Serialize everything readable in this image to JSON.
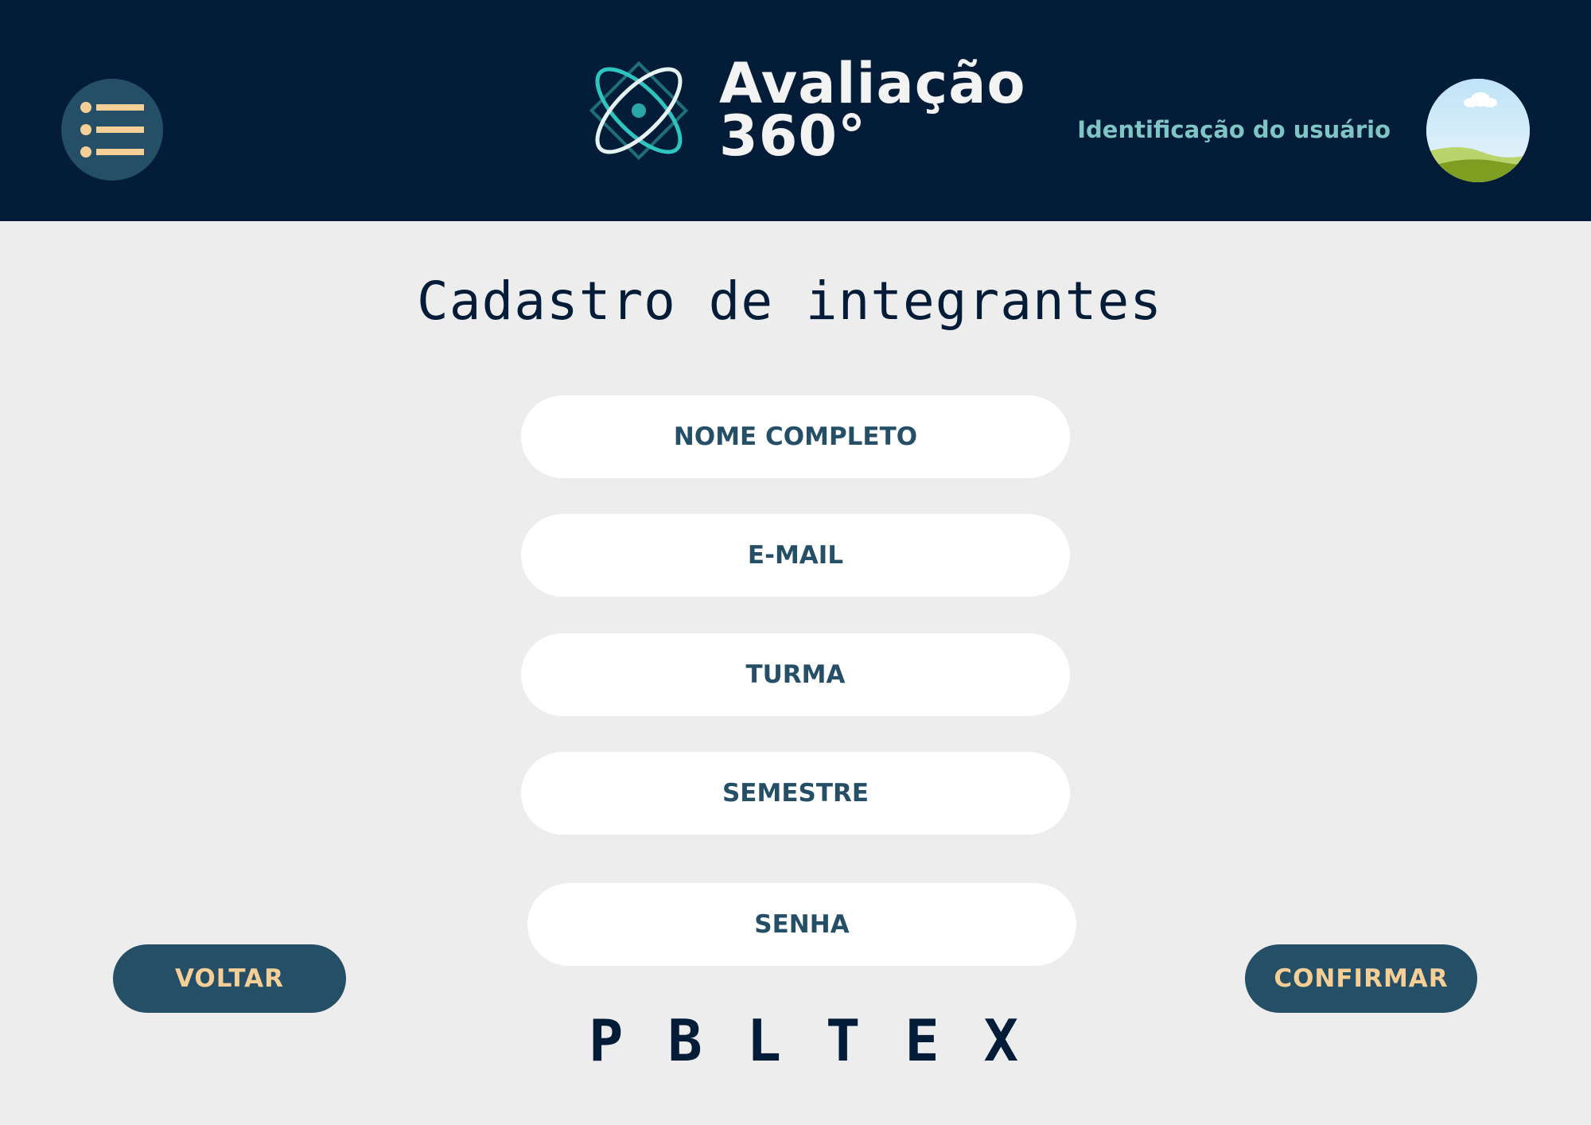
{
  "header": {
    "menu_icon": "list-menu-icon",
    "brand": {
      "line1": "Avaliação",
      "line2": "360°",
      "logo_icon": "atom-logo-icon"
    },
    "user_identification": "Identificação do usuário",
    "avatar_icon": "landscape-avatar-icon"
  },
  "main": {
    "title": "Cadastro de integrantes",
    "fields": {
      "name": {
        "placeholder": "NOME COMPLETO",
        "value": ""
      },
      "email": {
        "placeholder": "E-MAIL",
        "value": ""
      },
      "class": {
        "placeholder": "TURMA",
        "value": ""
      },
      "semester": {
        "placeholder": "SEMESTRE",
        "value": ""
      },
      "password": {
        "placeholder": "SENHA",
        "value": ""
      }
    },
    "back_label": "VOLTAR",
    "confirm_label": "CONFIRMAR"
  },
  "footer": {
    "letters": [
      "P",
      "B",
      "L",
      "T",
      "E",
      "X"
    ]
  },
  "colors": {
    "header_bg": "#031c37",
    "page_bg": "#ededed",
    "accent": "#244f66",
    "button_text": "#f6cf97",
    "user_id_text": "#7fc5c5",
    "logo_teal": "#2ec4c0"
  }
}
